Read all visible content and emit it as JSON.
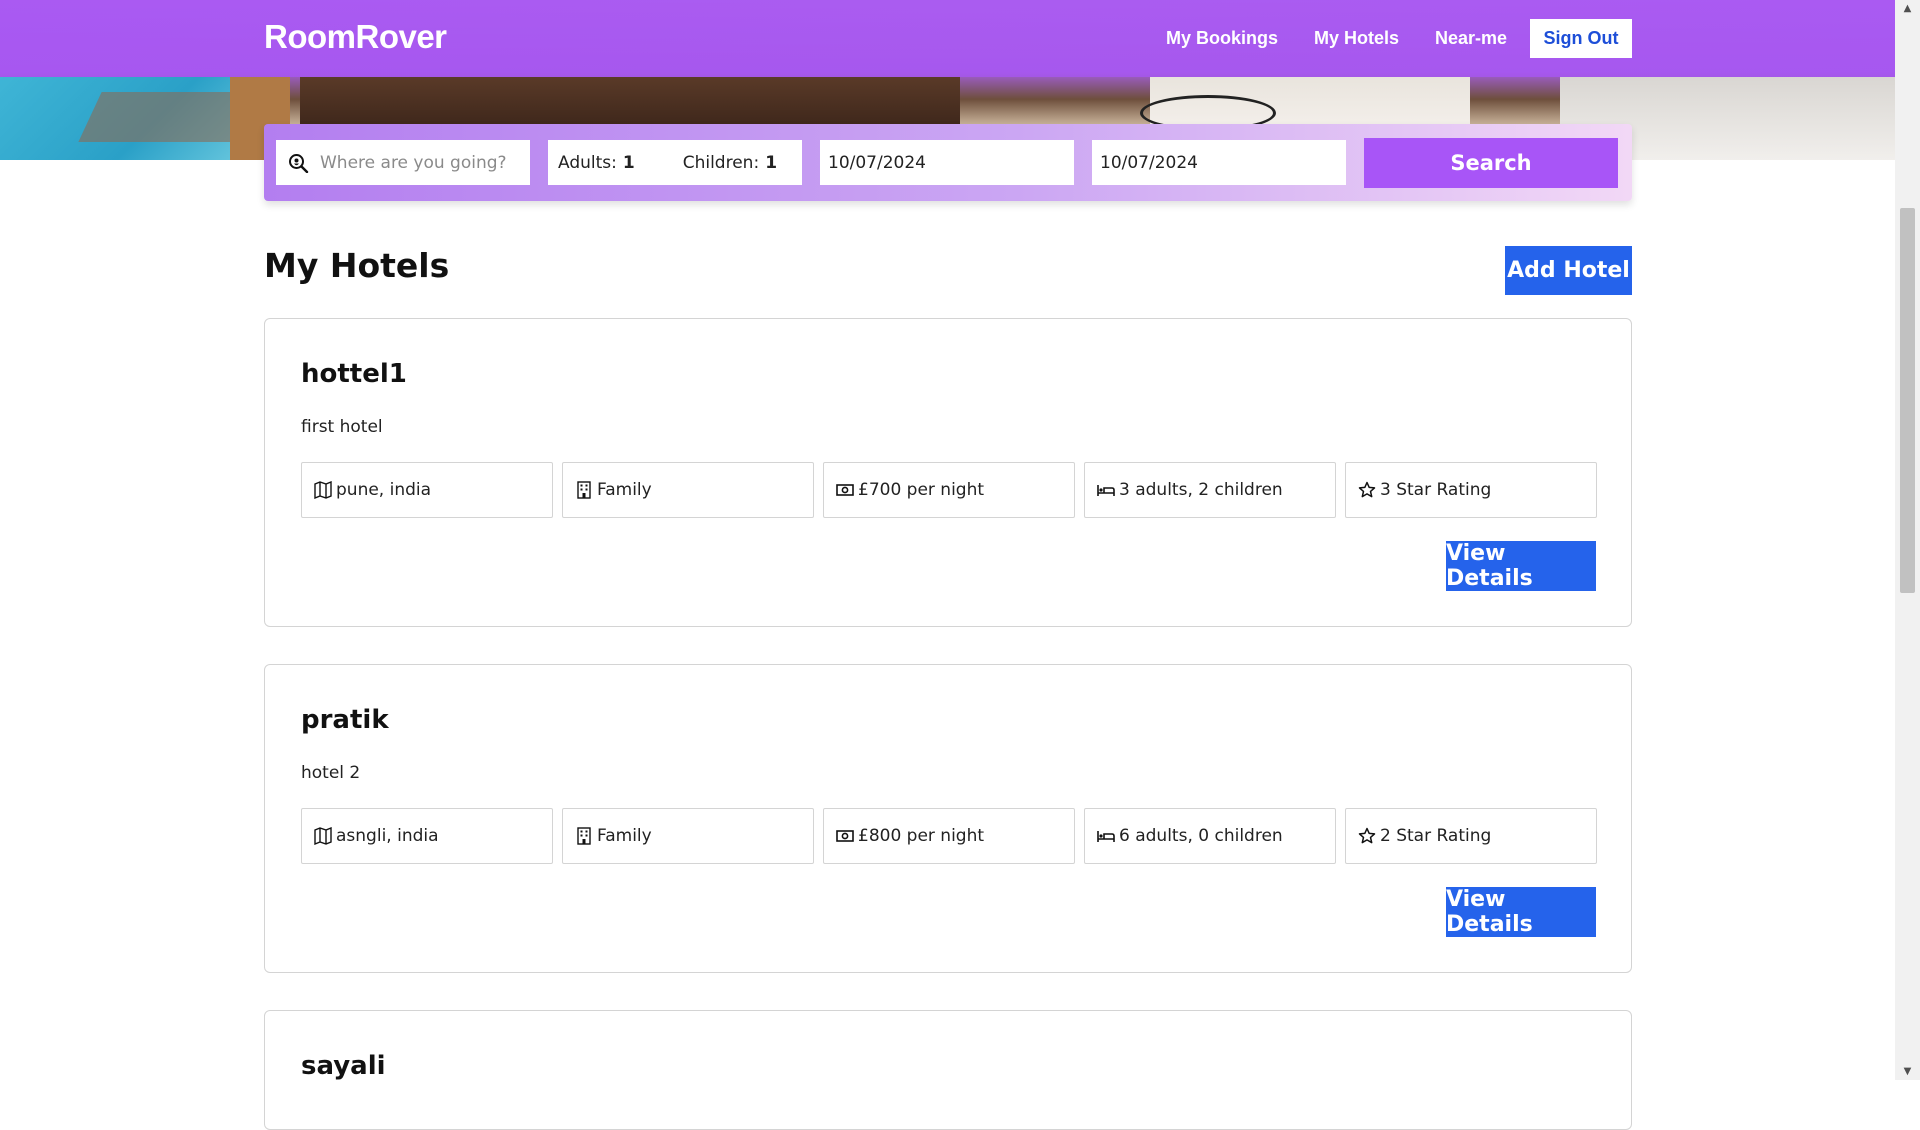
{
  "header": {
    "logo": "RoomRover",
    "nav": [
      "My Bookings",
      "My Hotels",
      "Near-me"
    ],
    "sign_out": "Sign Out"
  },
  "search": {
    "destination_placeholder": "Where are you going?",
    "adults_label": "Adults:",
    "adults_value": "1",
    "children_label": "Children:",
    "children_value": "1",
    "check_in": "10/07/2024",
    "check_out": "10/07/2024",
    "button": "Search"
  },
  "main": {
    "title": "My Hotels",
    "add_button": "Add Hotel",
    "hotels": [
      {
        "name": "hottel1",
        "description": "first hotel",
        "location": "pune, india",
        "type": "Family",
        "price": "£700 per night",
        "guests": "3 adults, 2 children",
        "rating": "3 Star Rating",
        "button": "View Details"
      },
      {
        "name": "pratik",
        "description": "hotel 2",
        "location": "asngli, india",
        "type": "Family",
        "price": "£800 per night",
        "guests": "6 adults, 0 children",
        "rating": "2 Star Rating",
        "button": "View Details"
      },
      {
        "name": "sayali"
      }
    ]
  },
  "colors": {
    "brand_purple": "#a855f7",
    "primary_blue": "#2563eb"
  },
  "icons": [
    "search-location-icon",
    "map-icon",
    "building-icon",
    "money-icon",
    "bed-icon",
    "star-icon"
  ]
}
